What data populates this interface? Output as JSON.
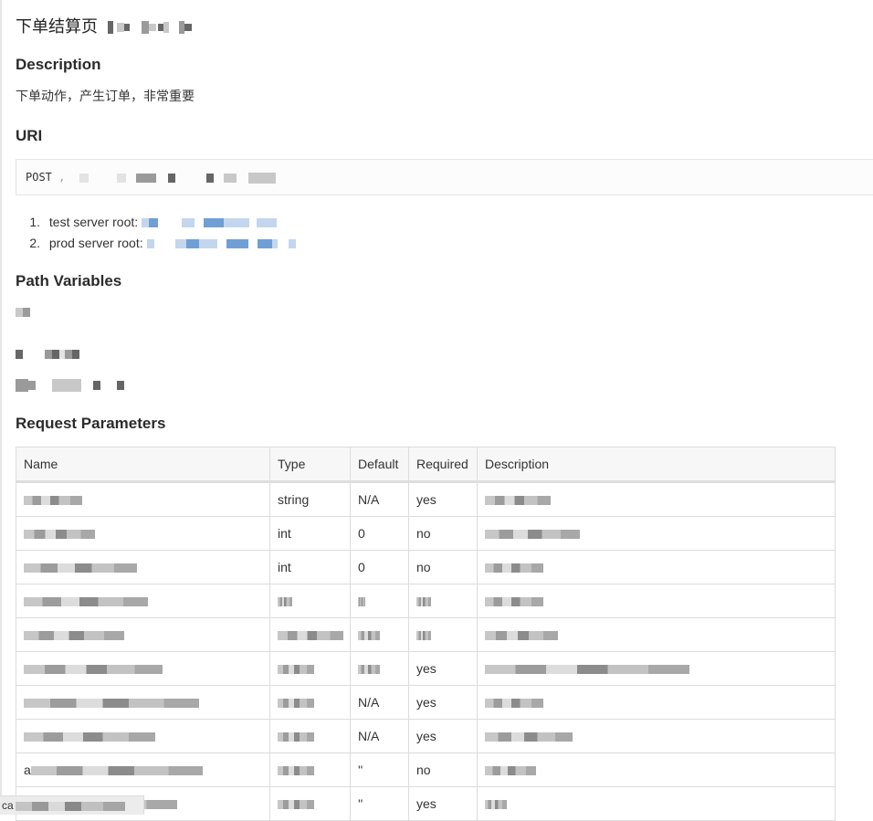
{
  "page": {
    "title": "下单结算页",
    "title_redacted": "[redacted]"
  },
  "sections": {
    "description": {
      "heading": "Description",
      "text": "下单动作，产生订单，非常重要"
    },
    "uri": {
      "heading": "URI",
      "method": "POST",
      "path_redacted": "/[redacted]",
      "servers": [
        {
          "index": "1.",
          "label": "test server root:",
          "url_redacted": "[redacted link]"
        },
        {
          "index": "2.",
          "label": "prod server root:",
          "url_redacted": "[redacted link]"
        }
      ]
    },
    "path_variables": {
      "heading": "Path Variables",
      "items_redacted": [
        "[redacted]",
        "[redacted]",
        "[redacted]"
      ]
    },
    "request_parameters": {
      "heading": "Request Parameters",
      "columns": [
        "Name",
        "Type",
        "Default",
        "Required",
        "Description"
      ],
      "rows": [
        {
          "name": "[redacted]",
          "type": "string",
          "default": "N/A",
          "required": "yes",
          "description": "[redacted]"
        },
        {
          "name": "[redacted]",
          "type": "int",
          "default": "0",
          "required": "no",
          "description": "[redacted]"
        },
        {
          "name": "[redacted]",
          "type": "int",
          "default": "0",
          "required": "no",
          "description": "[redacted]"
        },
        {
          "name": "[redacted]",
          "type": "[redacted]",
          "default": "[redacted]",
          "required": "[redacted]",
          "description": "[redacted]"
        },
        {
          "name": "[redacted]",
          "type": "[redacted]",
          "default": "[redacted]",
          "required": "[redacted]",
          "description": "[redacted]"
        },
        {
          "name": "[redacted]",
          "type": "[redacted]",
          "default": "[redacted]",
          "required": "yes",
          "description": "[redacted]"
        },
        {
          "name": "[redacted]",
          "type": "[redacted]",
          "default": "N/A",
          "required": "yes",
          "description": "[redacted]"
        },
        {
          "name": "[redacted]",
          "type": "[redacted]",
          "default": "N/A",
          "required": "yes",
          "description": "[redacted]"
        },
        {
          "name": "a[redacted]",
          "type": "[redacted]",
          "default": "''",
          "required": "no",
          "description": "[redacted]"
        },
        {
          "name": "[redacted]",
          "type": "[redacted]",
          "default": "''",
          "required": "yes",
          "description": "[redacted]"
        }
      ]
    }
  },
  "status_tooltip": {
    "text": "ca"
  },
  "colors": {
    "text": "#333333",
    "table_border": "#dcdcdc",
    "table_header_bg": "#f7f7f7",
    "link_redaction": "#6f9fd4",
    "code_box_bg": "#fcfcfc"
  }
}
